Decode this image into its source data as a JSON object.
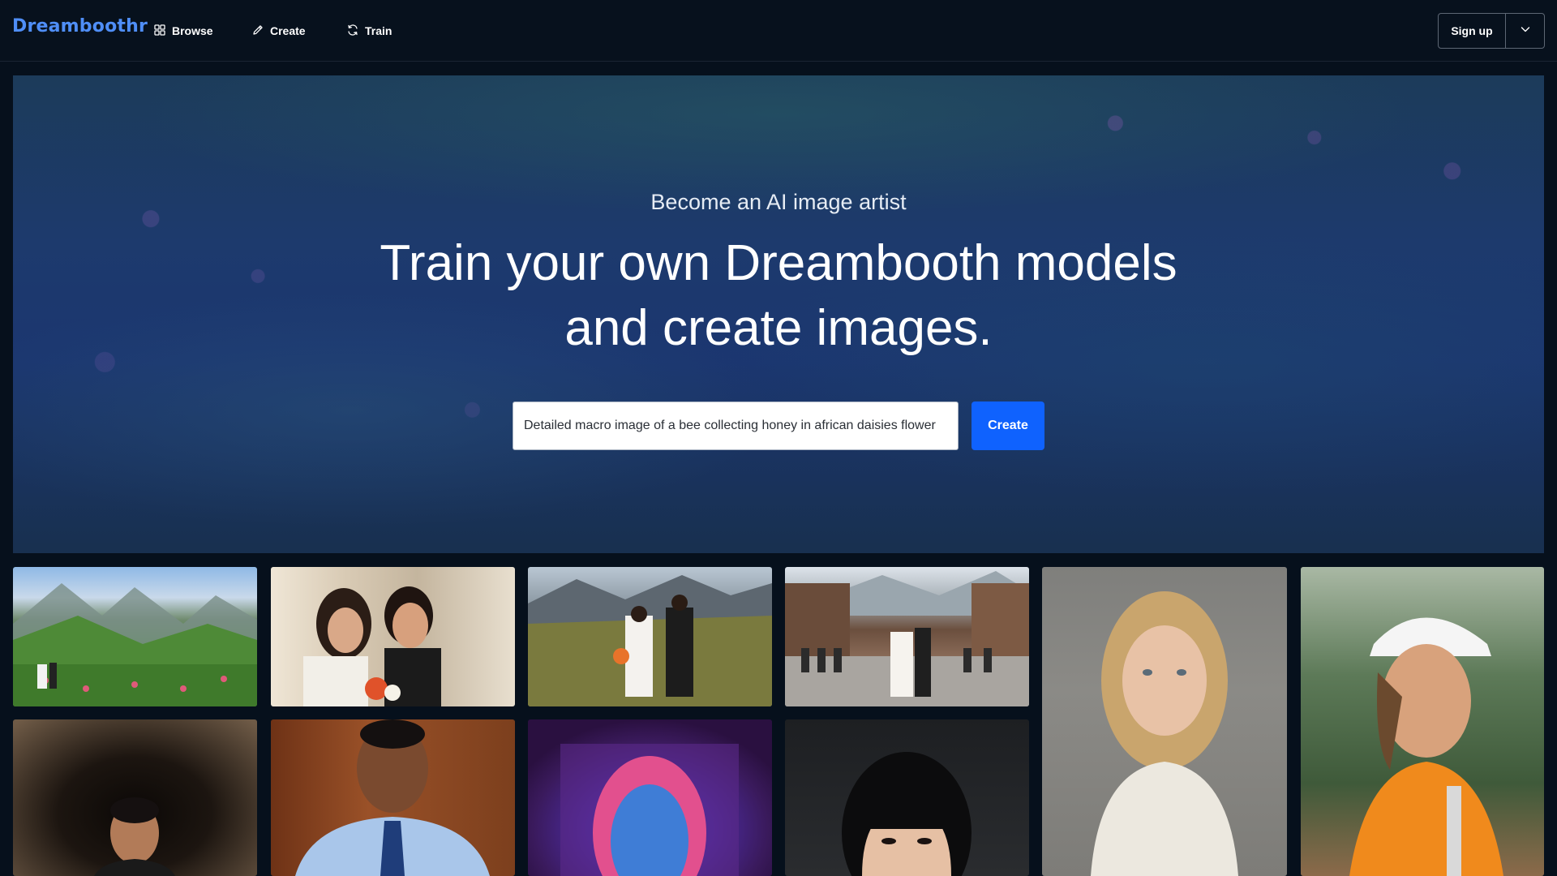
{
  "header": {
    "logo": "Dreamboothr",
    "nav": [
      {
        "label": "Browse",
        "icon": "grid-icon"
      },
      {
        "label": "Create",
        "icon": "pencil-icon"
      },
      {
        "label": "Train",
        "icon": "refresh-icon"
      }
    ],
    "signup_label": "Sign up",
    "dropdown_icon": "chevron-down-icon"
  },
  "hero": {
    "subtitle": "Become an AI image artist",
    "title_line1": "Train your own Dreambooth models",
    "title_line2": "and create images.",
    "prompt_value": "Detailed macro image of a bee collecting honey in african daisies flower",
    "create_label": "Create"
  },
  "colors": {
    "accent": "#0f62fe",
    "logo": "#4f8ef7",
    "background": "#06101c"
  },
  "gallery": [
    {
      "subject": "wedding couple in mountain meadow with flowers"
    },
    {
      "subject": "bride and groom close-up with bouquet"
    },
    {
      "subject": "bride and groom walking on mountain road"
    },
    {
      "subject": "wedding procession in alpine village street"
    },
    {
      "subject": "portrait of blonde woman in white sweater"
    },
    {
      "subject": "smiling woman in white hard hat and orange safety vest"
    },
    {
      "subject": "portrait of smiling man in dark arched hallway"
    },
    {
      "subject": "smiling man in blue shirt and tie"
    },
    {
      "subject": "neon pink and blue stylized portrait of woman"
    },
    {
      "subject": "portrait of woman with black bangs"
    }
  ]
}
